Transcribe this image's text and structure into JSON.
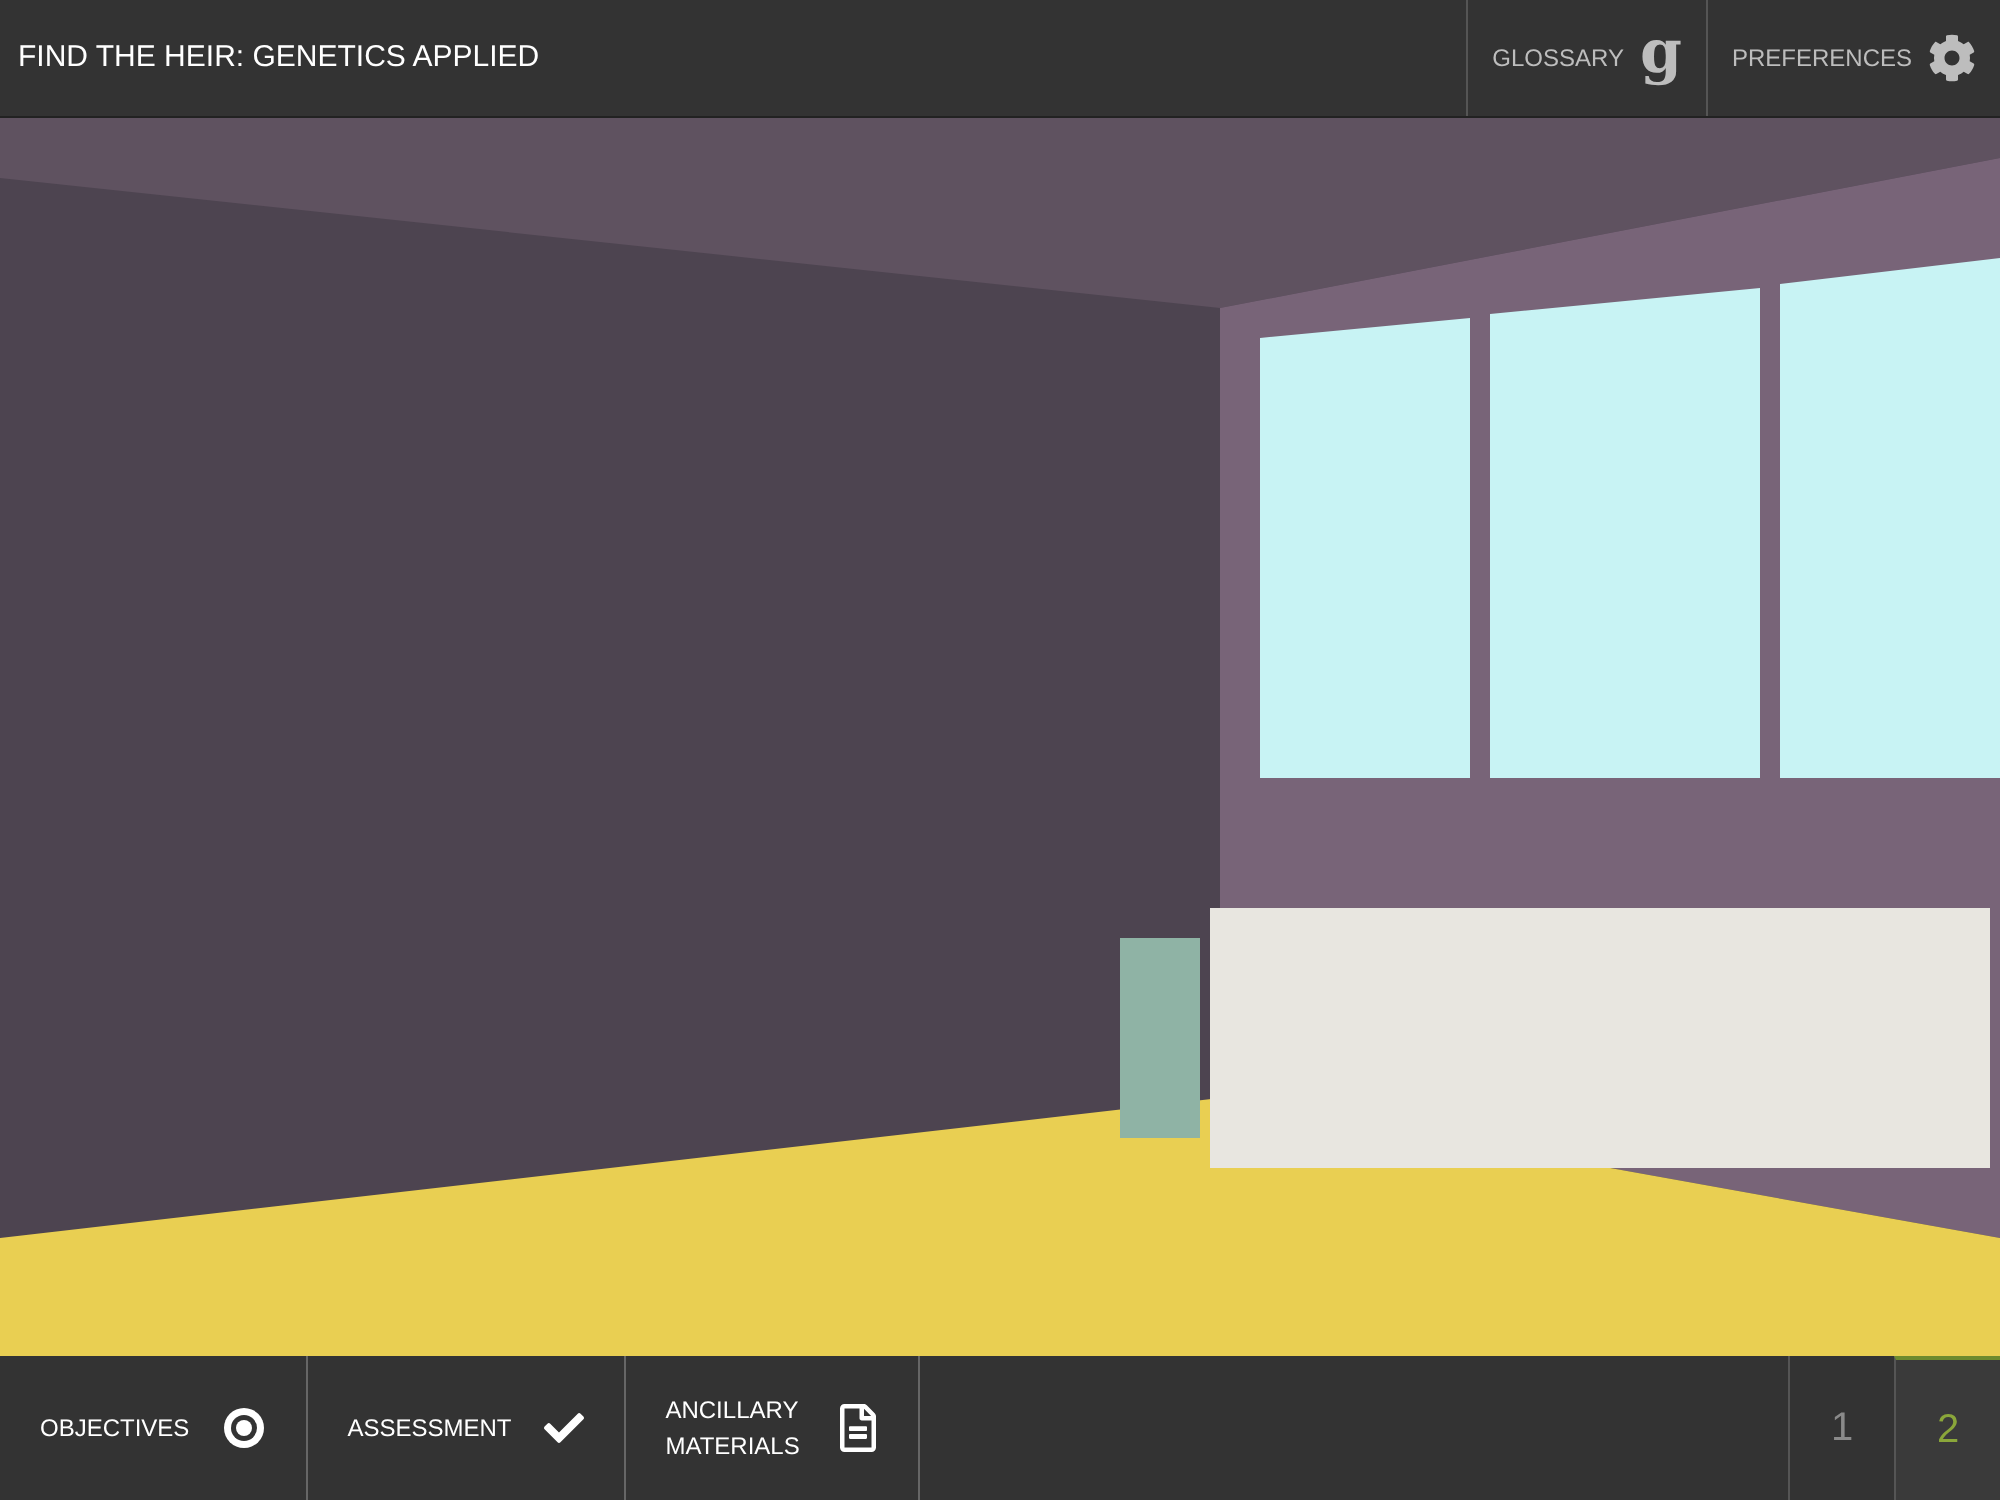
{
  "title": "FIND THE HEIR: GENETICS APPLIED",
  "header_buttons": [
    {
      "kind": "glossary",
      "label": "GLOSSARY",
      "glyph": "g"
    },
    {
      "kind": "preferences",
      "label": "PREFERENCES"
    }
  ],
  "footer_buttons": [
    {
      "kind": "objectives",
      "label": "OBJECTIVES"
    },
    {
      "kind": "assessment",
      "label": "ASSESSMENT"
    },
    {
      "kind": "materials",
      "label": "ANCILLARY MATERIALS"
    }
  ],
  "pages": [
    {
      "label": "1",
      "selected": false
    },
    {
      "label": "2",
      "selected": true
    }
  ]
}
